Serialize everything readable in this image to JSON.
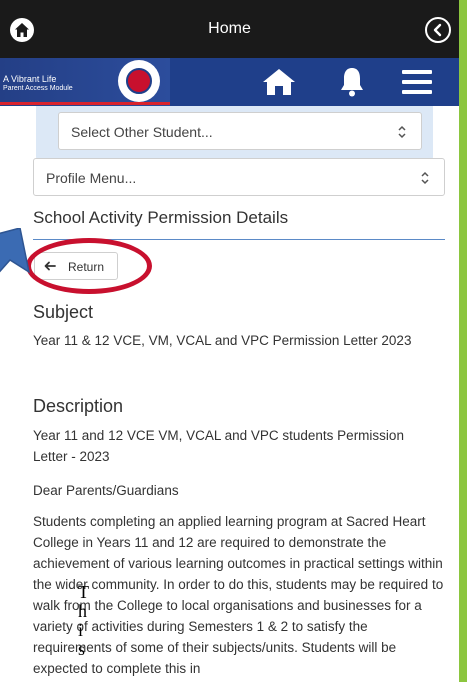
{
  "topbar": {
    "title": "Home"
  },
  "brand": {
    "line1": "A Vibrant Life",
    "line2": "Parent Access Module"
  },
  "student_select": {
    "value": "Select Other Student..."
  },
  "profile_select": {
    "value": "Profile Menu..."
  },
  "page": {
    "heading": "School Activity Permission Details"
  },
  "return_button": {
    "label": "Return"
  },
  "subject": {
    "title": "Subject",
    "text": "Year 11 & 12 VCE, VM, VCAL and VPC Permission Letter 2023"
  },
  "description": {
    "title": "Description",
    "p1": "Year 11 and 12 VCE VM, VCAL and VPC students Permission Letter - 2023",
    "p2": "Dear Parents/Guardians",
    "p3": "Students completing an applied learning program at Sacred Heart College in Years 11 and 12 are required to demonstrate the achievement of various learning outcomes in practical settings within the wider community. In order to do this, students may be required to walk from the College to local organisations and businesses for a variety of activities during Semesters 1 & 2 to satisfy the requirements of some of their subjects/units. Students will be expected to complete this in"
  },
  "overlay": {
    "letters": [
      "T",
      "h",
      "i",
      "s"
    ]
  },
  "colors": {
    "header_blue": "#1f3f8a",
    "accent_green": "#8cc63f",
    "annotation_red": "#c8102e",
    "rule_blue": "#5b8ac7"
  }
}
